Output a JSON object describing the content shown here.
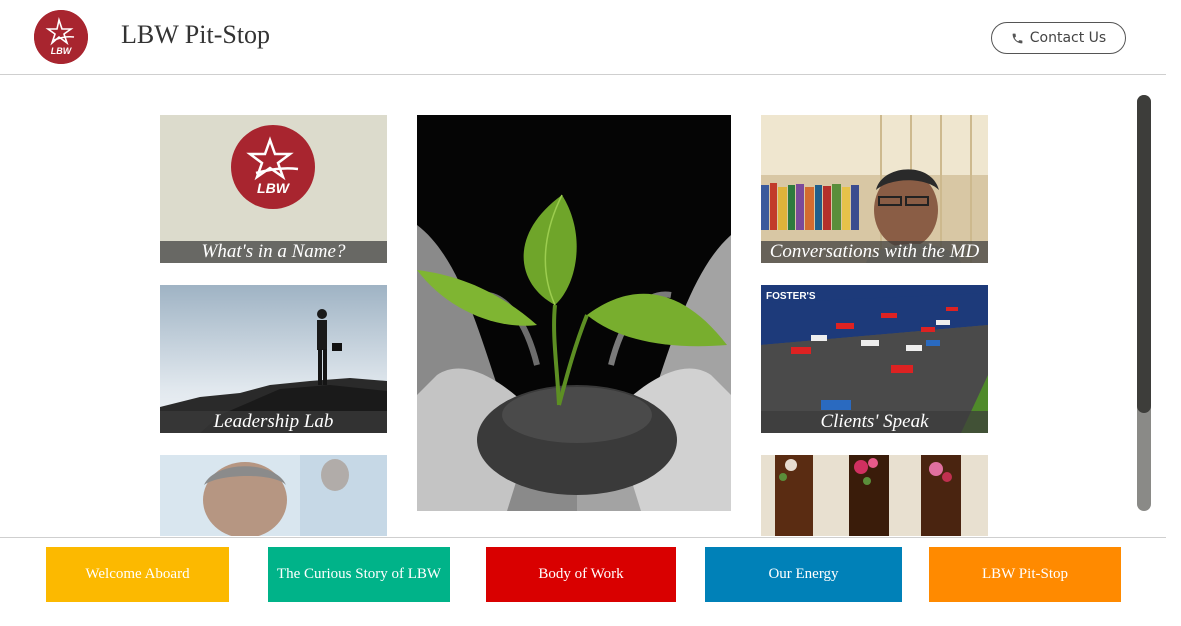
{
  "header": {
    "site_title": "LBW Pit-Stop",
    "logo_text": "LBW",
    "contact_label": "Contact Us",
    "contact_icon": "phone-icon"
  },
  "tiles": [
    {
      "caption": "What's in a Name?"
    },
    {
      "caption": "Leadership Lab"
    },
    {
      "caption": ""
    },
    {
      "caption": "Conversations with the MD"
    },
    {
      "caption": "Clients' Speak"
    },
    {
      "caption": ""
    }
  ],
  "bottom_nav": [
    {
      "label": "Welcome Aboard",
      "color": "#fcb900"
    },
    {
      "label": "The Curious Story of LBW",
      "color": "#00b389"
    },
    {
      "label": "Body of Work",
      "color": "#d90000"
    },
    {
      "label": "Our Energy",
      "color": "#0081b8"
    },
    {
      "label": "LBW Pit-Stop",
      "color": "#ff8a00"
    }
  ],
  "colors": {
    "brand_red": "#a8252f"
  }
}
